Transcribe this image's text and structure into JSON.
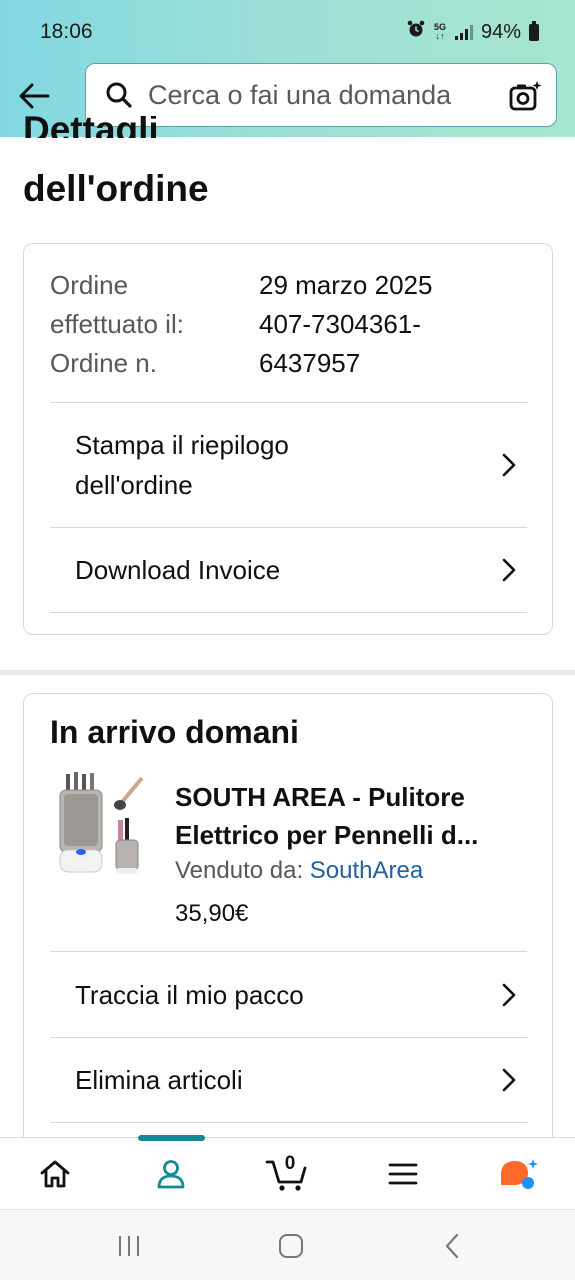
{
  "status_bar": {
    "time": "18:06",
    "battery": "94%",
    "network": "5G"
  },
  "search": {
    "placeholder": "Cerca o fai una domanda"
  },
  "page": {
    "title_partial": "Dettagli",
    "title": "dell'ordine"
  },
  "order_info": {
    "date_label": "Ordine",
    "date_label_2": "effettuato il:",
    "number_label": "Ordine n.",
    "date_value": "29 marzo 2025",
    "number_value_1": "407-7304361-",
    "number_value_2": "6437957"
  },
  "actions": {
    "print_line1": "Stampa il riepilogo",
    "print_line2": "dell'ordine",
    "download": "Download Invoice"
  },
  "shipment": {
    "heading": "In arrivo domani",
    "product_title_1": "SOUTH AREA - Pulitore",
    "product_title_2": "Elettrico per Pennelli d...",
    "sold_by_label": "Venduto da:",
    "seller": "SouthArea",
    "price": "35,90€",
    "track": "Traccia il mio pacco",
    "delete": "Elimina articoli"
  },
  "nav": {
    "cart_count": "0",
    "active_tab": "account"
  },
  "colors": {
    "header_gradient_start": "#82d8e1",
    "header_gradient_end": "#a6e6cf",
    "active_tab": "#138a96",
    "link": "#2162a1",
    "rufus_orange": "#ff6a2b",
    "rufus_blue": "#1e90ff"
  }
}
